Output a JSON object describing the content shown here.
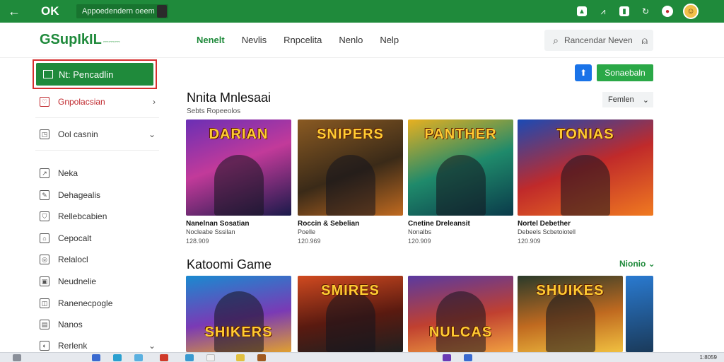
{
  "topbar": {
    "title": "OK",
    "url": "Appoedendern oeem"
  },
  "header": {
    "logo": "GSupIkIL",
    "logo_small": "⎓⎓⎓",
    "tabs": [
      "Nenelt",
      "Nevlis",
      "Rnpcelita",
      "Nenlo",
      "Nelp"
    ],
    "search_placeholder": "Rancendar Neven"
  },
  "sidebar": {
    "primary_button": "Nt: Pencadlin",
    "items": [
      {
        "label": "Gnpolacsian",
        "highlight": true,
        "chevron": "›"
      },
      {
        "label": "Ool casnin",
        "chevron": "⌄"
      },
      {
        "label": "Neka"
      },
      {
        "label": "Dehagealis"
      },
      {
        "label": "Rellebcabien"
      },
      {
        "label": "Cepocalt"
      },
      {
        "label": "Relalocl"
      },
      {
        "label": "Neudnelie"
      },
      {
        "label": "Ranenecpogle"
      },
      {
        "label": "Nanos"
      },
      {
        "label": "Rerlenk",
        "chevron": "⌄"
      }
    ]
  },
  "main": {
    "action_button": "Sonaebaln",
    "section1": {
      "title": "Nnita Mnlesaai",
      "subtitle": "Sebts Ropeeolos",
      "sort_label": "Femlen"
    },
    "cards_row1": [
      {
        "art_title": "DARIAN",
        "name": "Nanelnan Sosatian",
        "sub": "Nocleabe Sssilan",
        "price": "128.909",
        "bg": "linear-gradient(160deg,#6a2fb5 0%,#c23a9a 45%,#1a1a4a 100%)"
      },
      {
        "art_title": "SNIPERS",
        "name": "Roccin & Sebelian",
        "sub": "Poelle",
        "price": "120.969",
        "bg": "linear-gradient(160deg,#8a5a22 0%,#3a2a18 55%,#c06a20 100%)"
      },
      {
        "art_title": "PANTHER",
        "name": "Cnetine Dreleansit",
        "sub": "Nonalbs",
        "price": "120.909",
        "bg": "linear-gradient(160deg,#e8b020 0%,#1f8a6b 50%,#0a3a4a 100%)"
      },
      {
        "art_title": "TONIAS",
        "name": "Nortel Debether",
        "sub": "Debeels Scbetoiotell",
        "price": "120.909",
        "bg": "linear-gradient(160deg,#1a4ab5 0%,#c02a2a 50%,#f07a20 100%)"
      }
    ],
    "section2": {
      "title": "Katoomi Game",
      "more": "Nionio ⌄"
    },
    "cards_row2": [
      {
        "art_title": "SHIKERS",
        "bg": "linear-gradient(170deg,#1a8ad0 0%,#7a3ab5 55%,#e0a030 100%)"
      },
      {
        "art_title": "SMIRES",
        "bg": "linear-gradient(170deg,#d04a20 0%,#5a1a10 55%,#202020 100%)"
      },
      {
        "art_title": "NULCAS",
        "bg": "linear-gradient(170deg,#5a3aa0 0%,#c04030 55%,#f0a040 100%)"
      },
      {
        "art_title": "SHUIKES",
        "bg": "linear-gradient(170deg,#2a3a2a 0%,#c06a20 55%,#f0c040 100%)"
      },
      {
        "art_title": "",
        "bg": "linear-gradient(170deg,#2a7ad0 0%,#1a3a5a 100%)"
      }
    ]
  },
  "taskbar": {
    "clock": "1:8059"
  }
}
